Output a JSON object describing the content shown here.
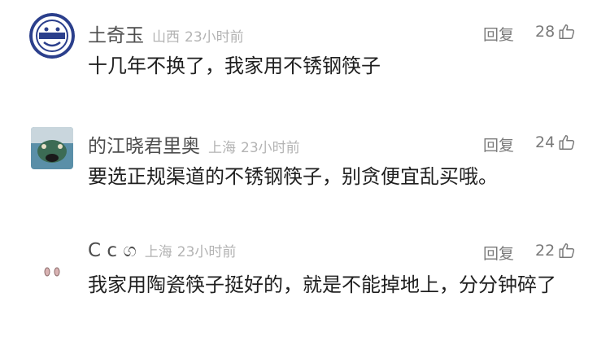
{
  "comments": [
    {
      "username": "土奇玉",
      "location": "山西",
      "time": "23小时前",
      "reply_label": "回复",
      "likes": "28",
      "content": "十几年不换了，我家用不锈钢筷子"
    },
    {
      "username": "的江晓君里奥",
      "location": "上海",
      "time": "23小时前",
      "reply_label": "回复",
      "likes": "24",
      "content": "要选正规渠道的不锈钢筷子，别贪便宜乱买哦。"
    },
    {
      "username": "C c ග",
      "location": "上海",
      "time": "23小时前",
      "reply_label": "回复",
      "likes": "22",
      "content": "我家用陶瓷筷子挺好的，就是不能掉地上，分分钟碎了"
    }
  ],
  "icons": {
    "like": "thumbs-up-icon"
  },
  "colors": {
    "username": "#4d4d4d",
    "meta": "#b3b3b3",
    "action": "#7a7a7a",
    "content": "#1f1f1f"
  }
}
